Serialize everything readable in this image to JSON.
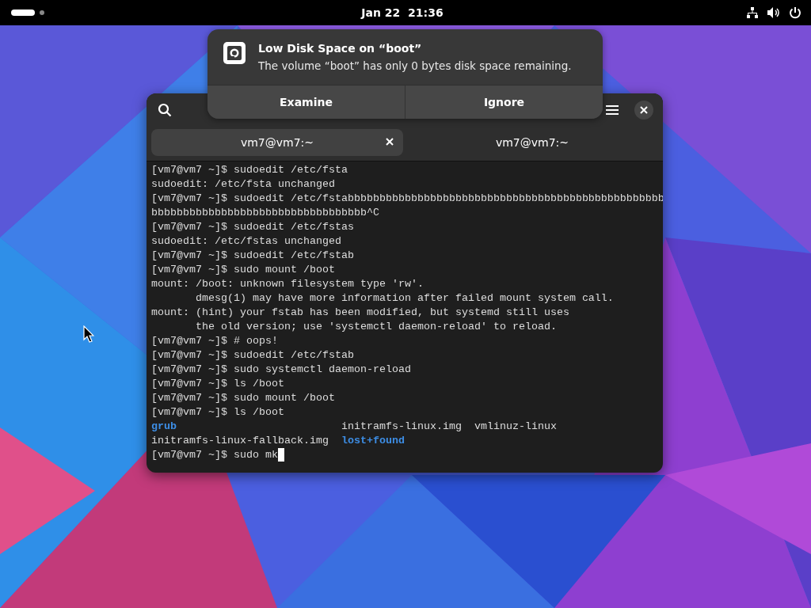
{
  "top_bar": {
    "clock": "Jan 22  21:36"
  },
  "notification": {
    "title": "Low Disk Space on “boot”",
    "body": "The volume “boot” has only 0 bytes disk space remaining.",
    "buttons": [
      "Examine",
      "Ignore"
    ]
  },
  "terminal": {
    "tabs": [
      {
        "label": "vm7@vm7:~",
        "selected": true
      },
      {
        "label": "vm7@vm7:~",
        "selected": false
      }
    ],
    "lines": [
      [
        {
          "text": "[vm7@vm7 ~]$ sudoedit /etc/fsta",
          "kind": "plain"
        }
      ],
      [
        {
          "text": "sudoedit: /etc/fsta unchanged",
          "kind": "plain"
        }
      ],
      [
        {
          "text": "[vm7@vm7 ~]$ sudoedit /etc/fstabbbbbbbbbbbbbbbbbbbbbbbbbbbbbbbbbbbbbbbbbbbbbbbbbb",
          "kind": "plain"
        }
      ],
      [
        {
          "text": "bbbbbbbbbbbbbbbbbbbbbbbbbbbbbbbbbb^C",
          "kind": "plain"
        }
      ],
      [
        {
          "text": "[vm7@vm7 ~]$ sudoedit /etc/fstas",
          "kind": "plain"
        }
      ],
      [
        {
          "text": "sudoedit: /etc/fstas unchanged",
          "kind": "plain"
        }
      ],
      [
        {
          "text": "[vm7@vm7 ~]$ sudoedit /etc/fstab",
          "kind": "plain"
        }
      ],
      [
        {
          "text": "[vm7@vm7 ~]$ sudo mount /boot",
          "kind": "plain"
        }
      ],
      [
        {
          "text": "mount: /boot: unknown filesystem type 'rw'.",
          "kind": "plain"
        }
      ],
      [
        {
          "text": "       dmesg(1) may have more information after failed mount system call.",
          "kind": "plain"
        }
      ],
      [
        {
          "text": "mount: (hint) your fstab has been modified, but systemd still uses",
          "kind": "plain"
        }
      ],
      [
        {
          "text": "       the old version; use 'systemctl daemon-reload' to reload.",
          "kind": "plain"
        }
      ],
      [
        {
          "text": "[vm7@vm7 ~]$ # oops!",
          "kind": "plain"
        }
      ],
      [
        {
          "text": "[vm7@vm7 ~]$ sudoedit /etc/fstab",
          "kind": "plain"
        }
      ],
      [
        {
          "text": "[vm7@vm7 ~]$ sudo systemctl daemon-reload",
          "kind": "plain"
        }
      ],
      [
        {
          "text": "[vm7@vm7 ~]$ ls /boot",
          "kind": "plain"
        }
      ],
      [
        {
          "text": "[vm7@vm7 ~]$ sudo mount /boot",
          "kind": "plain"
        }
      ],
      [
        {
          "text": "[vm7@vm7 ~]$ ls /boot",
          "kind": "plain"
        }
      ],
      [
        {
          "text": "grub",
          "kind": "dir"
        },
        {
          "text": "initramfs-linux.img",
          "kind": "plain"
        },
        {
          "text": "vmlinuz-linux",
          "kind": "plain"
        }
      ],
      [
        {
          "text": "initramfs-linux-fallback.img",
          "kind": "plain"
        },
        {
          "text": "lost+found",
          "kind": "dir"
        }
      ],
      [
        {
          "text": "[vm7@vm7 ~]$ sudo mk",
          "kind": "plain"
        },
        {
          "kind": "cursor"
        }
      ]
    ]
  }
}
